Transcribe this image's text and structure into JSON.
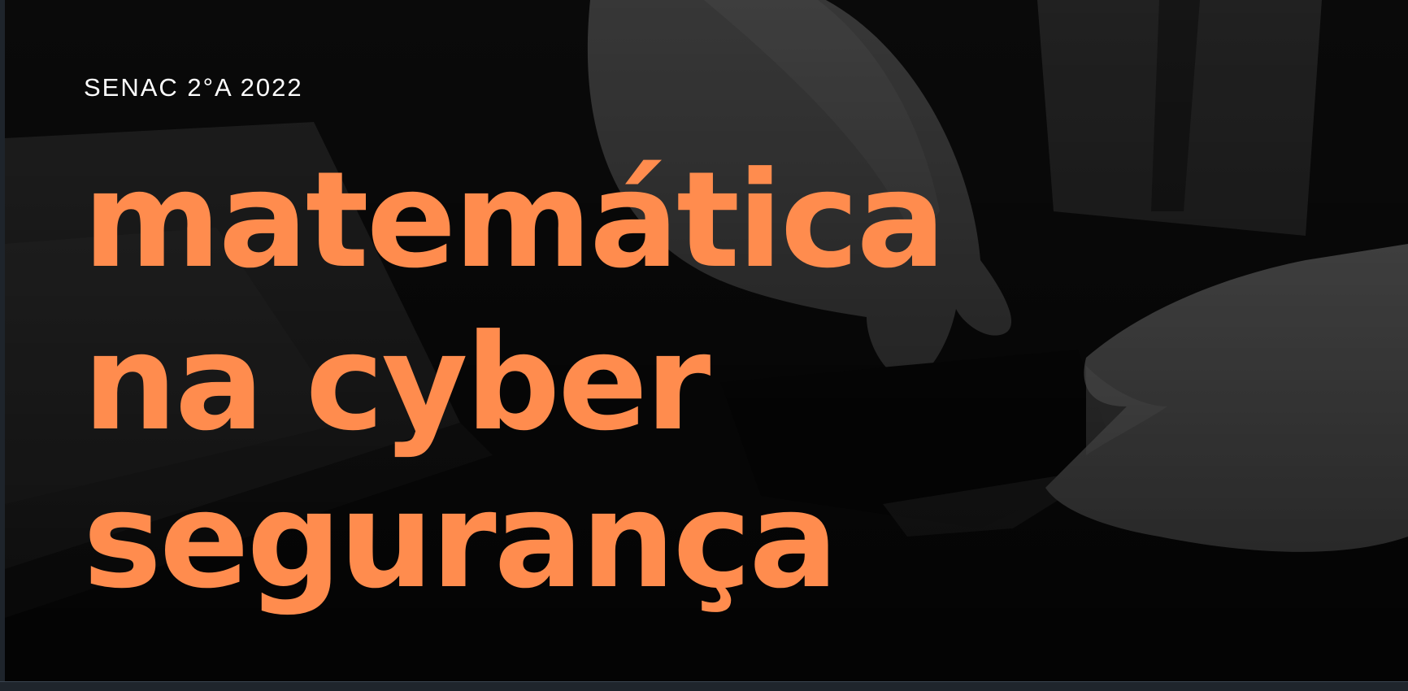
{
  "slide": {
    "subtitle": "SENAC 2°A 2022",
    "title_lines": [
      "matemática",
      "na cyber",
      "segurança"
    ]
  },
  "colors": {
    "title": "#ff8c4e",
    "subtitle": "#ffffff",
    "background": "#0c0c0c"
  }
}
